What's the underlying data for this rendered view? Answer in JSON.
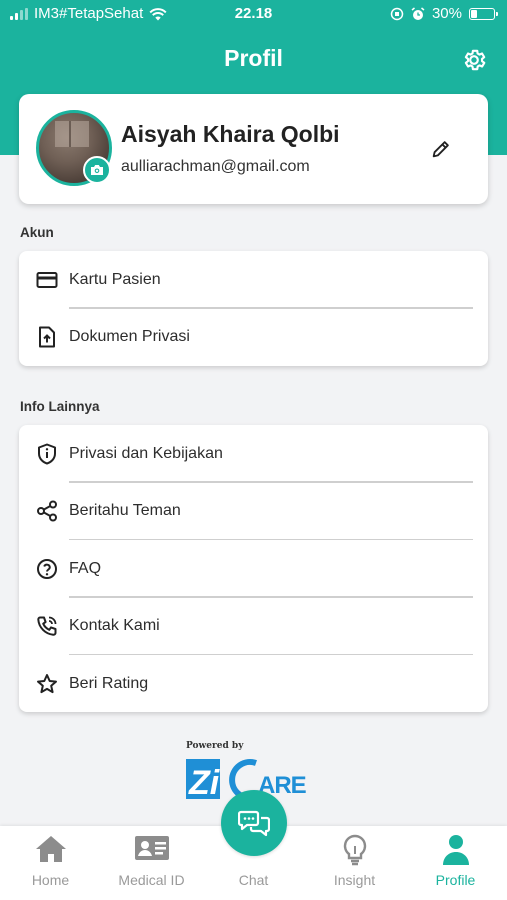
{
  "status_bar": {
    "carrier": "IM3#TetapSehat",
    "time": "22.18",
    "battery_percent": "30%",
    "battery_level": 0.3
  },
  "header": {
    "title": "Profil",
    "settings_icon": "gear-icon"
  },
  "profile": {
    "name": "Aisyah Khaira Qolbi",
    "email": "aulliarachman@gmail.com"
  },
  "sections": {
    "account": {
      "label": "Akun",
      "items": [
        {
          "label": "Kartu Pasien",
          "icon": "credit-card-icon"
        },
        {
          "label": "Dokumen Privasi",
          "icon": "document-upload-icon"
        }
      ]
    },
    "other": {
      "label": "Info Lainnya",
      "items": [
        {
          "label": "Privasi dan Kebijakan",
          "icon": "shield-icon"
        },
        {
          "label": "Beritahu Teman",
          "icon": "share-icon"
        },
        {
          "label": "FAQ",
          "icon": "help-circle-icon"
        },
        {
          "label": "Kontak Kami",
          "icon": "phone-call-icon"
        },
        {
          "label": "Beri Rating",
          "icon": "star-icon"
        }
      ]
    }
  },
  "branding": {
    "powered_by": "Powered by",
    "logo_text": "ZiCare"
  },
  "bottom_nav": {
    "items": [
      {
        "label": "Home",
        "icon": "home-icon"
      },
      {
        "label": "Medical ID",
        "icon": "id-card-icon"
      },
      {
        "label": "Chat",
        "icon": "chat-icon"
      },
      {
        "label": "Insight",
        "icon": "lightbulb-icon"
      },
      {
        "label": "Profile",
        "icon": "person-icon"
      }
    ],
    "active": "Profile"
  },
  "colors": {
    "brand": "#1bb39e",
    "inactive_nav": "#9a9a9a",
    "logo_blue": "#1f8fd6"
  }
}
